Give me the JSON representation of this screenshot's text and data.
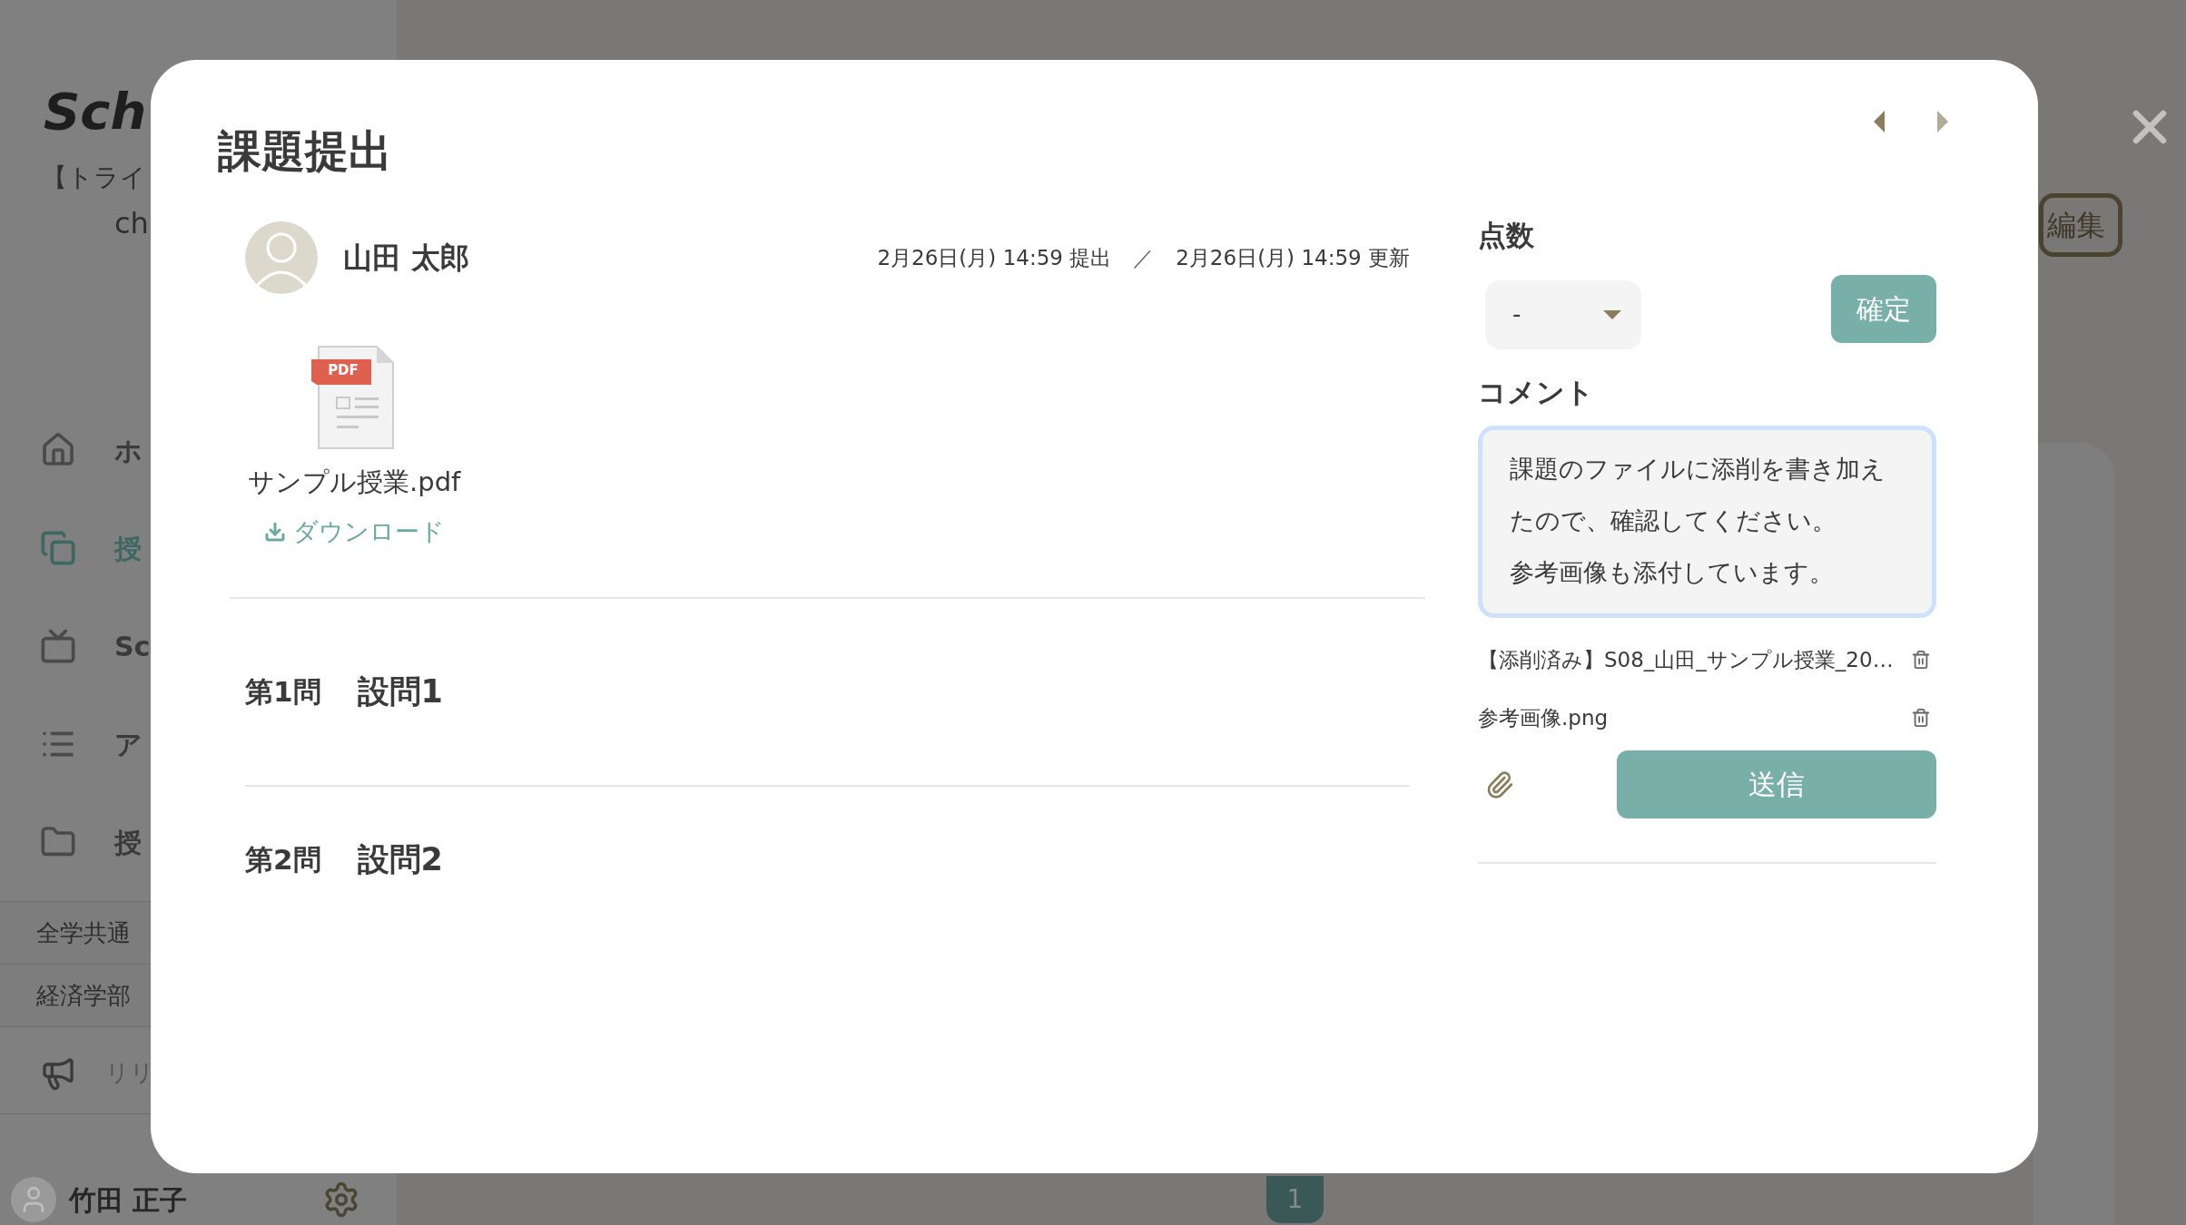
{
  "sidebar": {
    "logo": "Sch",
    "course": "【トライ",
    "course_line2": "ch",
    "nav": [
      {
        "label": "ホ",
        "selected": false
      },
      {
        "label": "授",
        "selected": true
      },
      {
        "label": "Sc",
        "selected": false
      },
      {
        "label": "ア",
        "selected": false
      },
      {
        "label": "授",
        "selected": false
      }
    ],
    "categories": [
      "全学共通",
      "経済学部"
    ],
    "release": "リリ",
    "user": "竹田 正子"
  },
  "main": {
    "edit_button": "編集",
    "pagination": [
      {
        "label": "1",
        "selected": true
      }
    ]
  },
  "modal": {
    "title": "課題提出",
    "nav_arrows": [
      {
        "kind": "prev",
        "disabled": false
      },
      {
        "kind": "next",
        "disabled": true
      }
    ],
    "student": "山田 太郎",
    "submitted": "2月26日(月) 14:59 提出",
    "separator": "／",
    "updated": "2月26日(月) 14:59 更新",
    "file": {
      "name": "サンプル授業.pdf",
      "badge": "PDF",
      "download": "ダウンロード"
    },
    "questions": [
      {
        "number": "第1問",
        "title": "設問1"
      },
      {
        "number": "第2問",
        "title": "設問2"
      }
    ],
    "score": {
      "label": "点数",
      "value": "-",
      "confirm": "確定"
    },
    "comment": {
      "label": "コメント",
      "lines": [
        "課題のファイルに添削を書き加えたので、確認してください。",
        "参考画像も添付しています。"
      ],
      "focused": true
    },
    "attachments": [
      {
        "name": "【添削済み】S08_山田_サンプル授業_20…"
      },
      {
        "name": "参考画像.png"
      }
    ],
    "send": "送信"
  }
}
